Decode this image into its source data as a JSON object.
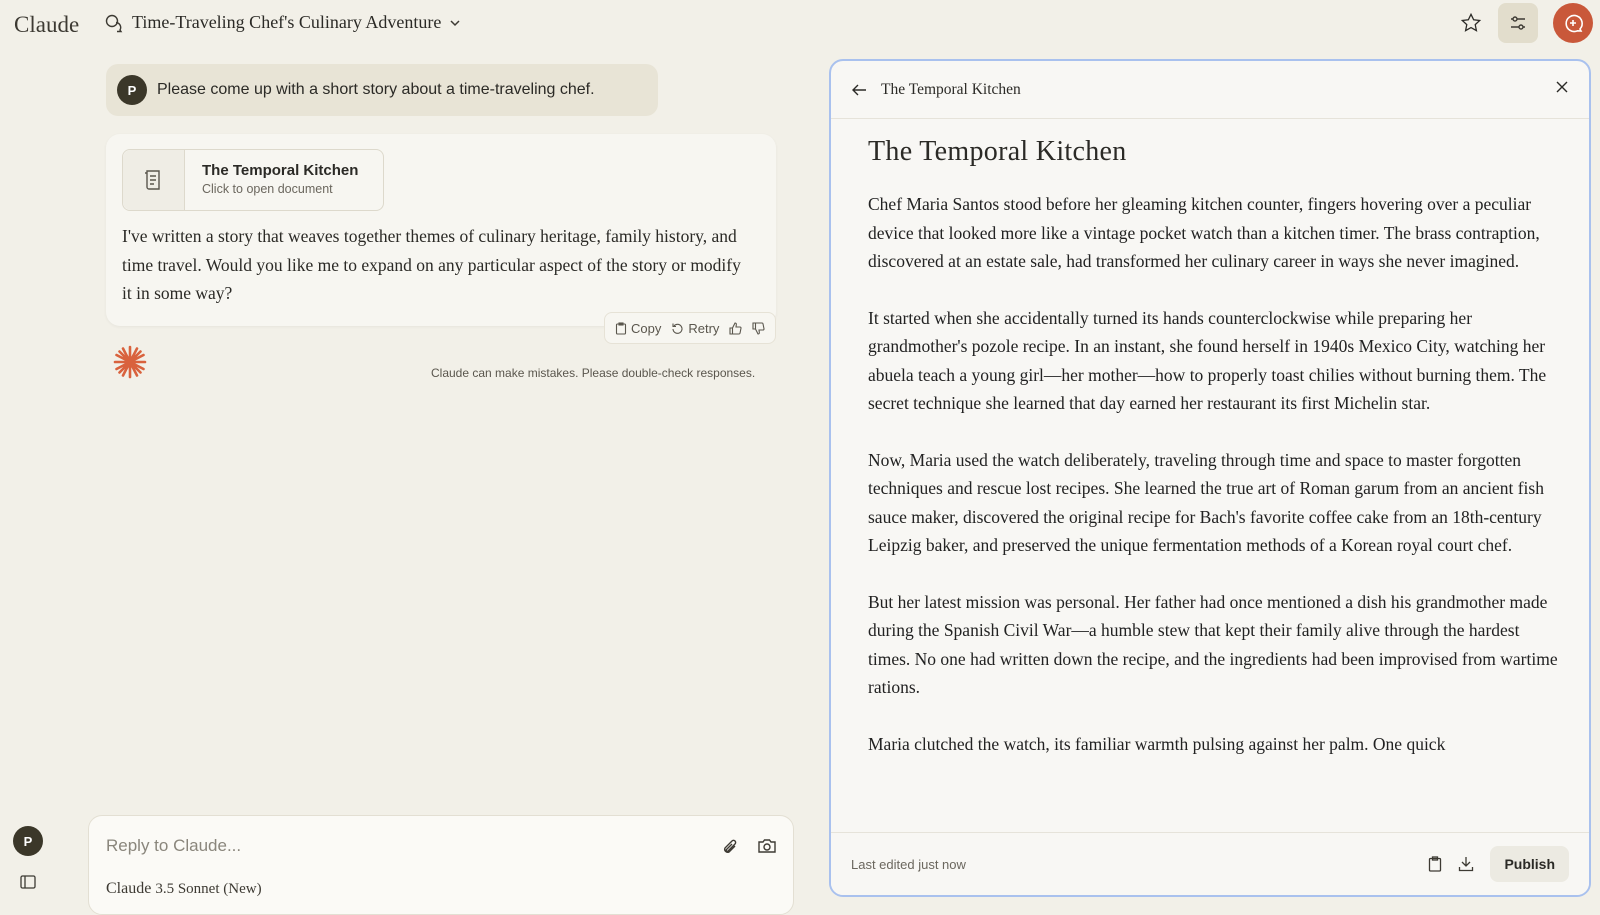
{
  "header": {
    "logo": "Claude",
    "conversation_title": "Time-Traveling Chef's Culinary Adventure",
    "accent": "#c9583a"
  },
  "user_message": {
    "avatar": "P",
    "text": "Please come up with a short story about a time-traveling chef."
  },
  "assistant": {
    "artifact_card": {
      "title": "The Temporal Kitchen",
      "subtitle": "Click to open document"
    },
    "text": "I've written a story that weaves together themes of culinary heritage, family history, and time travel. Would you like me to expand on any particular aspect of the story or modify it in some way?",
    "actions": {
      "copy": "Copy",
      "retry": "Retry"
    },
    "disclaimer": "Claude can make mistakes. Please double-check responses."
  },
  "composer": {
    "placeholder": "Reply to Claude...",
    "model_name": "Claude",
    "model_version": "3.5 Sonnet (New)"
  },
  "sidebar": {
    "avatar": "P"
  },
  "artifact": {
    "header_title": "The Temporal Kitchen",
    "title": "The Temporal Kitchen",
    "paragraphs": [
      "Chef Maria Santos stood before her gleaming kitchen counter, fingers hovering over a peculiar device that looked more like a vintage pocket watch than a kitchen timer. The brass contraption, discovered at an estate sale, had transformed her culinary career in ways she never imagined.",
      "It started when she accidentally turned its hands counterclockwise while preparing her grandmother's pozole recipe. In an instant, she found herself in 1940s Mexico City, watching her abuela teach a young girl—her mother—how to properly toast chilies without burning them. The secret technique she learned that day earned her restaurant its first Michelin star.",
      "Now, Maria used the watch deliberately, traveling through time and space to master forgotten techniques and rescue lost recipes. She learned the true art of Roman garum from an ancient fish sauce maker, discovered the original recipe for Bach's favorite coffee cake from an 18th-century Leipzig baker, and preserved the unique fermentation methods of a Korean royal court chef.",
      "But her latest mission was personal. Her father had once mentioned a dish his grandmother made during the Spanish Civil War—a humble stew that kept their family alive through the hardest times. No one had written down the recipe, and the ingredients had been improvised from wartime rations.",
      "Maria clutched the watch, its familiar warmth pulsing against her palm. One quick"
    ],
    "footer": {
      "status": "Last edited just now",
      "publish": "Publish"
    }
  }
}
